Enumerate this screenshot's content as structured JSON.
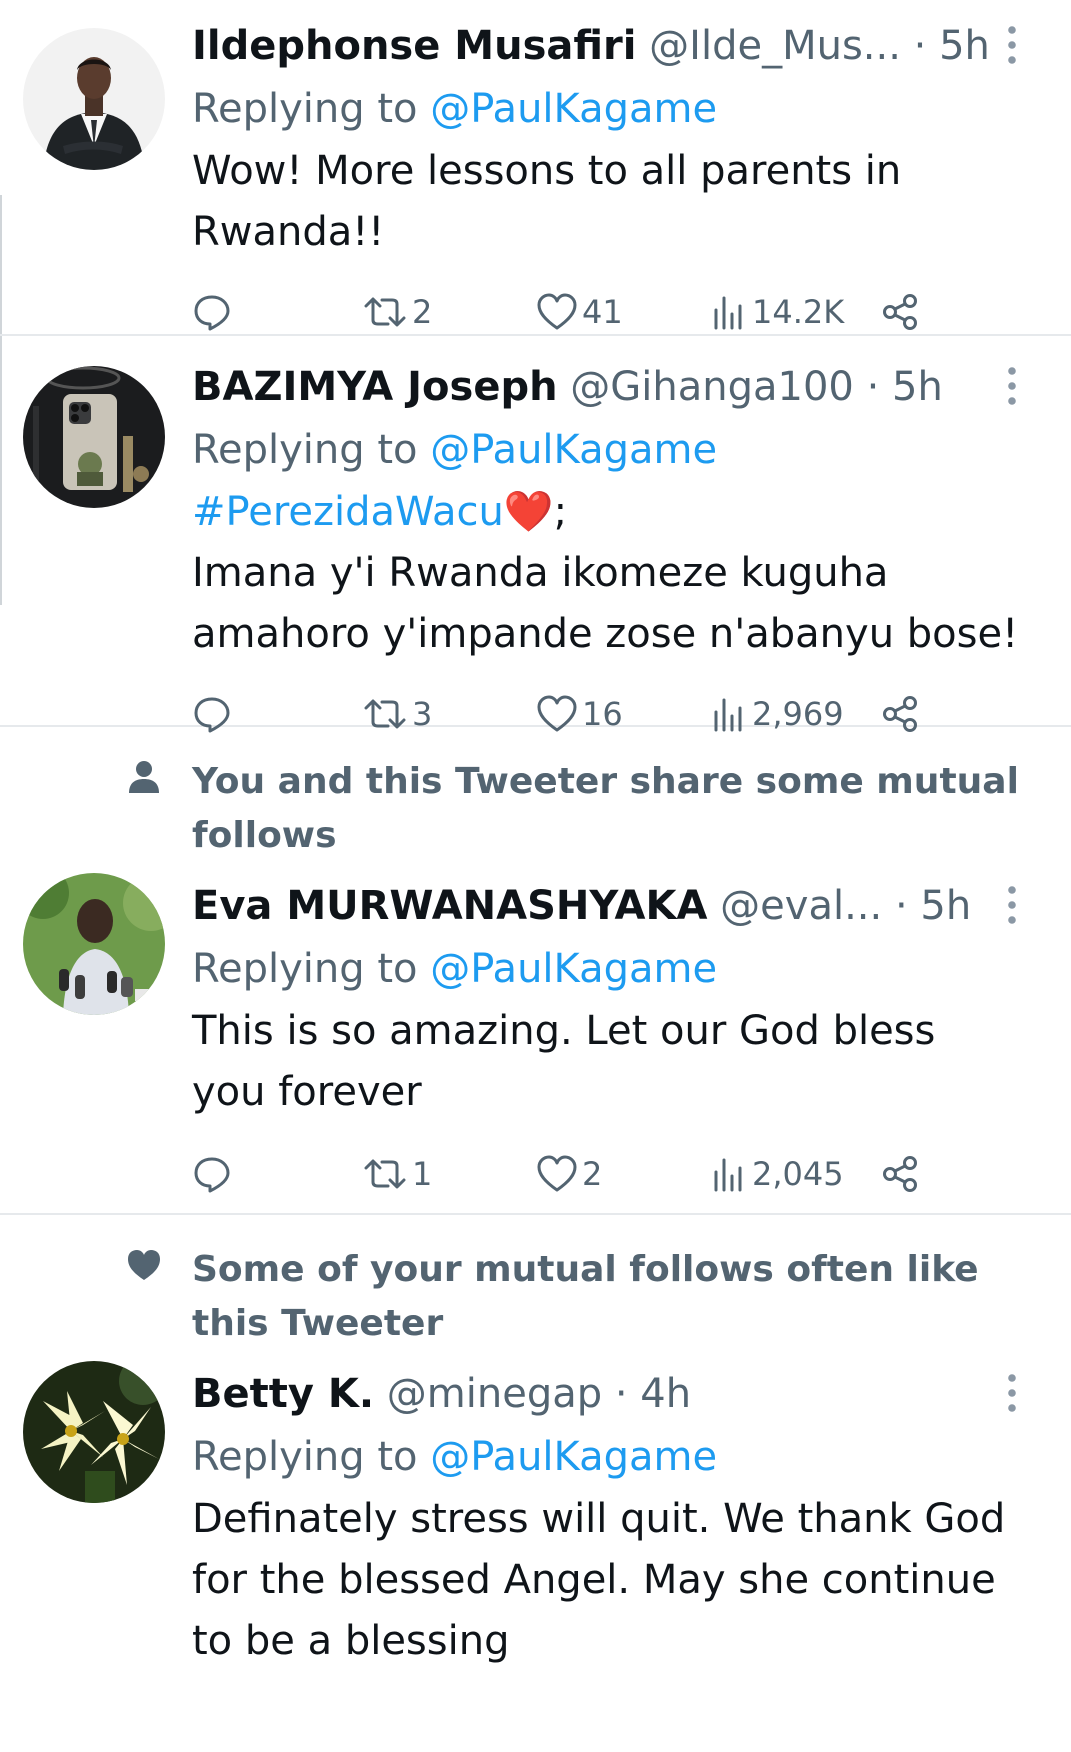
{
  "tweets": [
    {
      "name": "Ildephonse Musafiri",
      "handle": "@Ilde_Mus...",
      "dot": "·",
      "time": "5h",
      "reply_prefix": "Replying to",
      "reply_to": "@PaulKagame",
      "text_lines": [
        "Wow! More lessons to all parents in",
        "Rwanda!!"
      ],
      "retweets": "2",
      "likes": "41",
      "views": "14.2K"
    },
    {
      "name": "BAZIMYA Joseph",
      "handle": "@Gihanga100",
      "dot": "·",
      "time": "5h",
      "reply_prefix": "Replying to",
      "reply_to": "@PaulKagame",
      "hashtag": "#PerezidaWacu",
      "emoji": "❤️",
      "after_emoji": ";",
      "text_lines": [
        "Imana y'i Rwanda ikomeze kuguha",
        "amahoro y'impande zose n'abanyu bose!"
      ],
      "retweets": "3",
      "likes": "16",
      "views": "2,969"
    },
    {
      "social_context": "You and this Tweeter share some mutual follows",
      "social_icon": "person-icon",
      "name": "Eva MURWANASHYAKA",
      "handle": "@eval...",
      "dot": "·",
      "time": "5h",
      "reply_prefix": "Replying to",
      "reply_to": "@PaulKagame",
      "text_lines": [
        "This is so amazing. Let our God bless",
        "you forever"
      ],
      "retweets": "1",
      "likes": "2",
      "views": "2,045"
    },
    {
      "social_context": "Some of your mutual follows often like this Tweeter",
      "social_icon": "heart-icon",
      "name": "Betty K.",
      "handle": "@minegap",
      "dot": "·",
      "time": "4h",
      "reply_prefix": "Replying to",
      "reply_to": "@PaulKagame",
      "text_lines": [
        "Definately stress will quit. We thank God",
        "for the blessed Angel. May she continue",
        "to be a blessing"
      ]
    }
  ],
  "colors": {
    "accent": "#1d9bf0",
    "secondary_text": "#536471",
    "primary_text": "#0f1419",
    "divider": "#e6e9ec",
    "emoji_heart": "#e0245e"
  }
}
